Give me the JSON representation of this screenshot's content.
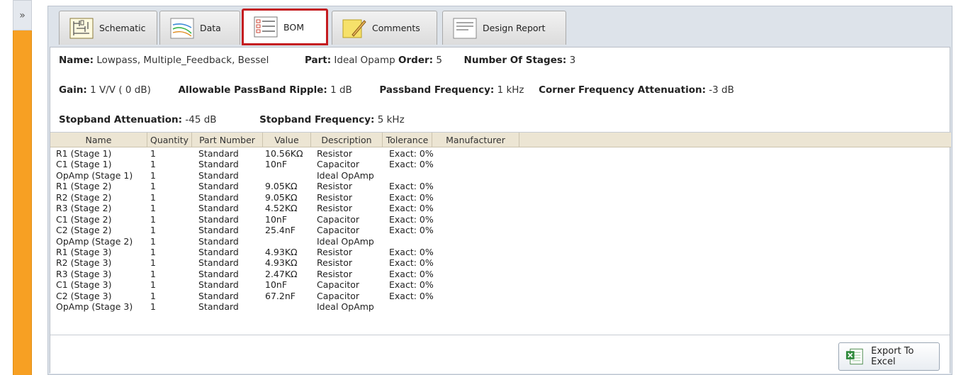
{
  "rail": {
    "toggle_glyph": "»",
    "bottom_glyph": "‹‹"
  },
  "tabs": [
    {
      "label": "Schematic",
      "icon": "schematic-icon"
    },
    {
      "label": "Data",
      "icon": "data-icon"
    },
    {
      "label": "BOM",
      "icon": "bom-icon",
      "active": true
    },
    {
      "label": "Comments",
      "icon": "comments-icon"
    },
    {
      "label": "Design Report",
      "icon": "design-report-icon"
    }
  ],
  "summary": {
    "name_k": "Name:",
    "name_v": "Lowpass, Multiple_Feedback, Bessel",
    "part_k": "Part:",
    "part_v": "Ideal Opamp",
    "order_k": "Order:",
    "order_v": "5",
    "stages_k": "Number Of Stages:",
    "stages_v": "3",
    "gain_k": "Gain:",
    "gain_v": "1 V/V ( 0 dB)",
    "ripple_k": "Allowable PassBand Ripple:",
    "ripple_v": "1 dB",
    "passfreq_k": "Passband Frequency:",
    "passfreq_v": "1 kHz",
    "corner_k": "Corner Frequency Attenuation:",
    "corner_v": "-3 dB",
    "stopatt_k": "Stopband Attenuation:",
    "stopatt_v": "-45 dB",
    "stopfreq_k": "Stopband Frequency:",
    "stopfreq_v": "5 kHz"
  },
  "grid": {
    "headers": [
      "Name",
      "Quantity",
      "Part Number",
      "Value",
      "Description",
      "Tolerance",
      "Manufacturer"
    ],
    "rows": [
      [
        "R1 (Stage 1)",
        "1",
        "Standard",
        "10.56KΩ",
        "Resistor",
        "Exact: 0%"
      ],
      [
        "C1 (Stage 1)",
        "1",
        "Standard",
        "10nF",
        "Capacitor",
        "Exact: 0%"
      ],
      [
        "OpAmp (Stage 1)",
        "1",
        "Standard",
        "",
        "Ideal OpAmp",
        ""
      ],
      [
        "R1 (Stage 2)",
        "1",
        "Standard",
        "9.05KΩ",
        "Resistor",
        "Exact: 0%"
      ],
      [
        "R2 (Stage 2)",
        "1",
        "Standard",
        "9.05KΩ",
        "Resistor",
        "Exact: 0%"
      ],
      [
        "R3 (Stage 2)",
        "1",
        "Standard",
        "4.52KΩ",
        "Resistor",
        "Exact: 0%"
      ],
      [
        "C1 (Stage 2)",
        "1",
        "Standard",
        "10nF",
        "Capacitor",
        "Exact: 0%"
      ],
      [
        "C2 (Stage 2)",
        "1",
        "Standard",
        "25.4nF",
        "Capacitor",
        "Exact: 0%"
      ],
      [
        "OpAmp (Stage 2)",
        "1",
        "Standard",
        "",
        "Ideal OpAmp",
        ""
      ],
      [
        "R1 (Stage 3)",
        "1",
        "Standard",
        "4.93KΩ",
        "Resistor",
        "Exact: 0%"
      ],
      [
        "R2 (Stage 3)",
        "1",
        "Standard",
        "4.93KΩ",
        "Resistor",
        "Exact: 0%"
      ],
      [
        "R3 (Stage 3)",
        "1",
        "Standard",
        "2.47KΩ",
        "Resistor",
        "Exact: 0%"
      ],
      [
        "C1 (Stage 3)",
        "1",
        "Standard",
        "10nF",
        "Capacitor",
        "Exact: 0%"
      ],
      [
        "C2 (Stage 3)",
        "1",
        "Standard",
        "67.2nF",
        "Capacitor",
        "Exact: 0%"
      ],
      [
        "OpAmp (Stage 3)",
        "1",
        "Standard",
        "",
        "Ideal OpAmp",
        ""
      ]
    ]
  },
  "footer": {
    "export_label": "Export To Excel",
    "export_icon": "excel-icon"
  },
  "colors": {
    "accent_rail": "#f7a023",
    "active_tab_border": "#c41b20",
    "grid_header": "#ece5d3"
  }
}
